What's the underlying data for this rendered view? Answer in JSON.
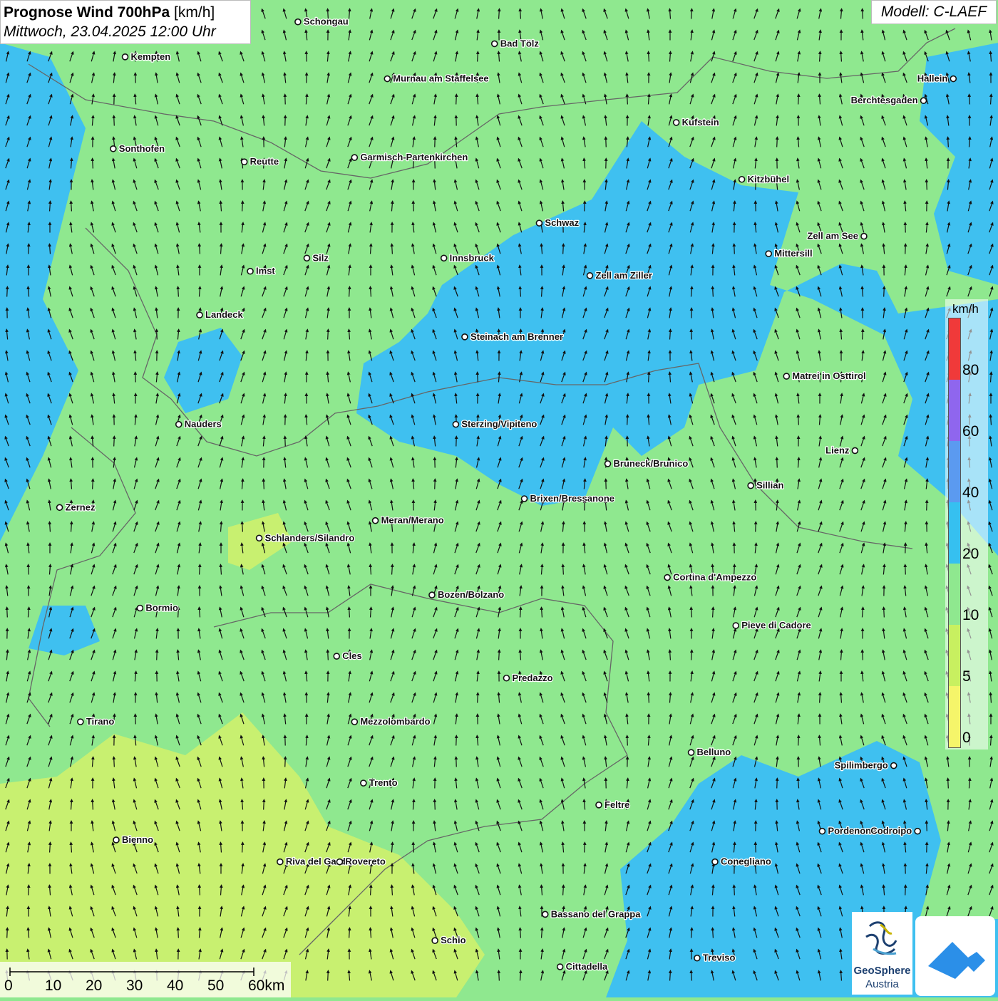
{
  "header": {
    "title_main": "Prognose Wind 700hPa",
    "title_unit": "[km/h]",
    "datetime": "Mittwoch, 23.04.2025 12:00 Uhr",
    "model": "Modell: C-LAEF"
  },
  "colors": {
    "land_green": "#8fe88f",
    "wind_blue": "#3fc0f0",
    "calm_yellow": "#c8f070",
    "border": "#666666"
  },
  "legend": {
    "unit": "km/h",
    "ticks": [
      "0",
      "5",
      "10",
      "20",
      "40",
      "60",
      "80"
    ],
    "segments": [
      {
        "from": 0,
        "to": 5,
        "color": "#f5f56a"
      },
      {
        "from": 5,
        "to": 10,
        "color": "#c8f060"
      },
      {
        "from": 10,
        "to": 20,
        "color": "#8fe88f"
      },
      {
        "from": 20,
        "to": 40,
        "color": "#36c0f0"
      },
      {
        "from": 40,
        "to": 60,
        "color": "#5b9af0"
      },
      {
        "from": 60,
        "to": 80,
        "color": "#8f66ee"
      },
      {
        "from": 80,
        "to": 100,
        "color": "#f03a3a"
      }
    ]
  },
  "scalebar": {
    "labels": [
      "0",
      "10",
      "20",
      "30",
      "40",
      "50",
      "60km"
    ]
  },
  "logos": {
    "geosphere_line1": "GeoSphere",
    "geosphere_line2": "Austria"
  },
  "cities": [
    {
      "name": "Schongau",
      "lon": 10.9,
      "lat": 47.81
    },
    {
      "name": "Bad Tölz",
      "lon": 11.56,
      "lat": 47.76
    },
    {
      "name": "Kempten",
      "lon": 10.32,
      "lat": 47.73
    },
    {
      "name": "Murnau am Staffelsee",
      "lon": 11.2,
      "lat": 47.68
    },
    {
      "name": "Hallein",
      "lon": 13.1,
      "lat": 47.68
    },
    {
      "name": "Berchtesgaden",
      "lon": 13.0,
      "lat": 47.63
    },
    {
      "name": "Kufstein",
      "lon": 12.17,
      "lat": 47.58
    },
    {
      "name": "Sonthofen",
      "lon": 10.28,
      "lat": 47.52
    },
    {
      "name": "Reutte",
      "lon": 10.72,
      "lat": 47.49
    },
    {
      "name": "Garmisch-Partenkirchen",
      "lon": 11.09,
      "lat": 47.5
    },
    {
      "name": "Kitzbühel",
      "lon": 12.39,
      "lat": 47.45
    },
    {
      "name": "Schwaz",
      "lon": 11.71,
      "lat": 47.35
    },
    {
      "name": "Zell am See",
      "lon": 12.8,
      "lat": 47.32
    },
    {
      "name": "Mittersill",
      "lon": 12.48,
      "lat": 47.28
    },
    {
      "name": "Innsbruck",
      "lon": 11.39,
      "lat": 47.27
    },
    {
      "name": "Silz",
      "lon": 10.93,
      "lat": 47.27
    },
    {
      "name": "Imst",
      "lon": 10.74,
      "lat": 47.24
    },
    {
      "name": "Zell am Ziller",
      "lon": 11.88,
      "lat": 47.23
    },
    {
      "name": "Landeck",
      "lon": 10.57,
      "lat": 47.14
    },
    {
      "name": "Steinach am Brenner",
      "lon": 11.46,
      "lat": 47.09
    },
    {
      "name": "Matrei in Osttirol",
      "lon": 12.54,
      "lat": 47.0
    },
    {
      "name": "Sterzing/Vipiteno",
      "lon": 11.43,
      "lat": 46.89
    },
    {
      "name": "Nauders",
      "lon": 10.5,
      "lat": 46.89
    },
    {
      "name": "Lienz",
      "lon": 12.77,
      "lat": 46.83
    },
    {
      "name": "Bruneck/Brunico",
      "lon": 11.94,
      "lat": 46.8
    },
    {
      "name": "Sillian",
      "lon": 12.42,
      "lat": 46.75
    },
    {
      "name": "Brixen/Bressanone",
      "lon": 11.66,
      "lat": 46.72
    },
    {
      "name": "Zernez",
      "lon": 10.1,
      "lat": 46.7
    },
    {
      "name": "Meran/Merano",
      "lon": 11.16,
      "lat": 46.67
    },
    {
      "name": "Schlanders/Silandro",
      "lon": 10.77,
      "lat": 46.63
    },
    {
      "name": "Cortina d'Ampezzo",
      "lon": 12.14,
      "lat": 46.54
    },
    {
      "name": "Bozen/Bolzano",
      "lon": 11.35,
      "lat": 46.5
    },
    {
      "name": "Bormio",
      "lon": 10.37,
      "lat": 46.47
    },
    {
      "name": "Pieve di Cadore",
      "lon": 12.37,
      "lat": 46.43
    },
    {
      "name": "Cles",
      "lon": 11.03,
      "lat": 46.36
    },
    {
      "name": "Predazzo",
      "lon": 11.6,
      "lat": 46.31
    },
    {
      "name": "Tirano",
      "lon": 10.17,
      "lat": 46.21
    },
    {
      "name": "Mezzolombardo",
      "lon": 11.09,
      "lat": 46.21
    },
    {
      "name": "Belluno",
      "lon": 12.22,
      "lat": 46.14
    },
    {
      "name": "Spilimbergo",
      "lon": 12.9,
      "lat": 46.11
    },
    {
      "name": "Trento",
      "lon": 11.12,
      "lat": 46.07
    },
    {
      "name": "Feltre",
      "lon": 11.91,
      "lat": 46.02
    },
    {
      "name": "Pordenone",
      "lon": 12.66,
      "lat": 45.96
    },
    {
      "name": "Codroipo",
      "lon": 12.98,
      "lat": 45.96
    },
    {
      "name": "Bienno",
      "lon": 10.29,
      "lat": 45.94
    },
    {
      "name": "Conegliano",
      "lon": 12.3,
      "lat": 45.89
    },
    {
      "name": "Riva del Garda",
      "lon": 10.84,
      "lat": 45.89
    },
    {
      "name": "Rovereto",
      "lon": 11.04,
      "lat": 45.89
    },
    {
      "name": "Bassano del Grappa",
      "lon": 11.73,
      "lat": 45.77
    },
    {
      "name": "Schio",
      "lon": 11.36,
      "lat": 45.71
    },
    {
      "name": "Treviso",
      "lon": 12.24,
      "lat": 45.67
    },
    {
      "name": "Cittadella",
      "lon": 11.78,
      "lat": 45.65
    }
  ]
}
